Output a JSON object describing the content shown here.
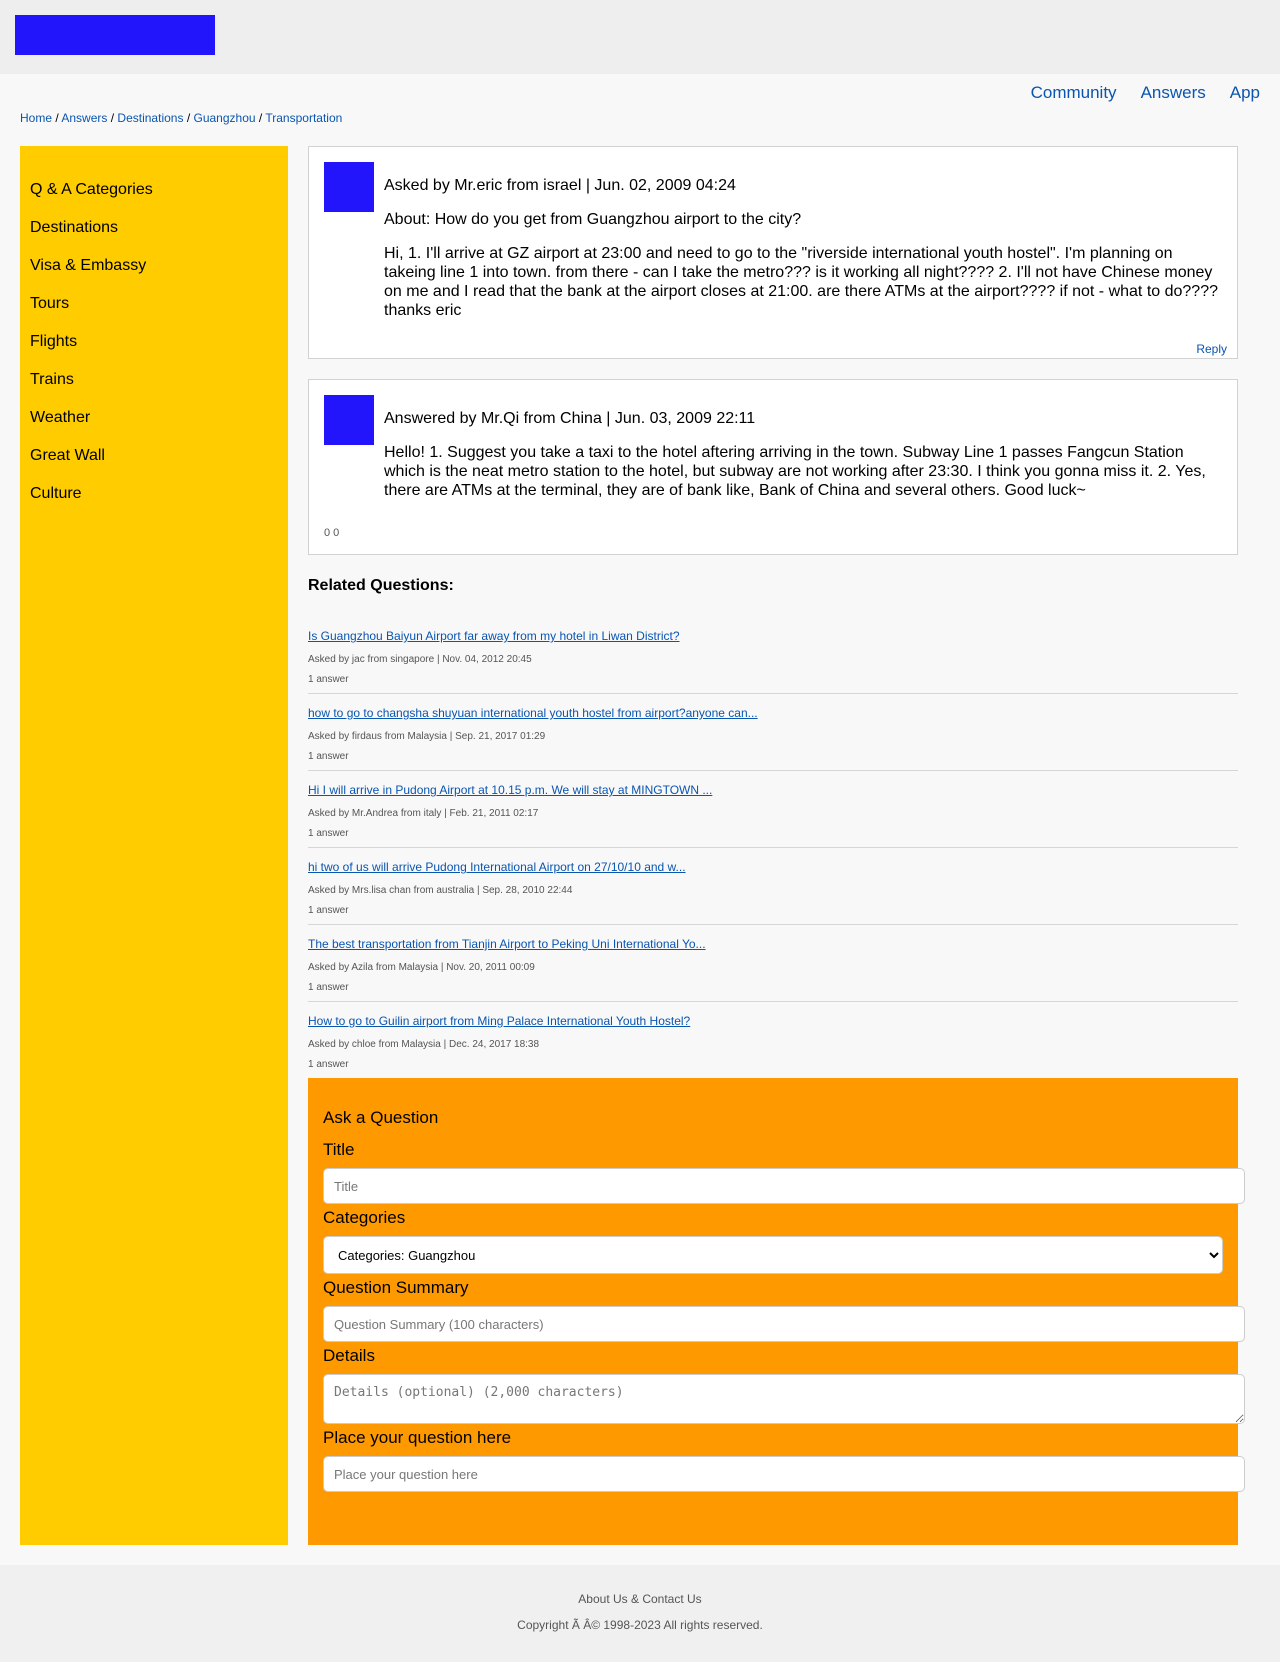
{
  "colors": {
    "logo": "#2215fb",
    "sidebar": "#ffcc00",
    "ask_panel": "#ff9900",
    "link": "#0a55b0"
  },
  "nav": {
    "community": "Community",
    "answers": "Answers",
    "app": "App"
  },
  "breadcrumb": {
    "home": "Home",
    "sep": "/",
    "answers": "Answers",
    "destinations": "Destinations",
    "guangzhou": "Guangzhou",
    "transportation": "Transportation"
  },
  "sidebar": {
    "items": [
      "Q & A Categories",
      "Destinations",
      "Visa & Embassy",
      "Tours",
      "Flights",
      "Trains",
      "Weather",
      "Great Wall",
      "Culture"
    ]
  },
  "question": {
    "meta": "Asked by Mr.eric from israel | Jun. 02, 2009 04:24",
    "about": "About: How do you get from Guangzhou airport to the city?",
    "text": "Hi, 1. I'll arrive at GZ airport at 23:00 and need to go to the \"riverside international youth hostel\". I'm planning on takeing line 1 into town. from there - can I take the metro??? is it working all night???? 2. I'll not have Chinese money on me and I read that the bank at the airport closes at 21:00. are there ATMs at the airport???? if not - what to do???? thanks eric",
    "reply_label": "Reply"
  },
  "answer": {
    "meta": "Answered by Mr.Qi from China | Jun. 03, 2009 22:11",
    "text": "Hello! 1. Suggest you take a taxi to the hotel aftering arriving in the town. Subway Line 1 passes Fangcun Station which is the neat metro station to the hotel, but subway are not working after 23:30. I think you gonna miss it. 2. Yes, there are ATMs at the terminal, they are of bank like, Bank of China and several others. Good luck~",
    "counts": "0 0"
  },
  "related": {
    "title": "Related Questions:",
    "items": [
      {
        "title": "Is Guangzhou Baiyun Airport far away from my hotel in Liwan District?",
        "meta": "Asked by jac from singapore | Nov. 04, 2012 20:45",
        "count": "1 answer"
      },
      {
        "title": "how to go to changsha shuyuan international youth hostel from airport?anyone can...",
        "meta": "Asked by firdaus from Malaysia | Sep. 21, 2017 01:29",
        "count": "1 answer"
      },
      {
        "title": "Hi I will arrive in Pudong Airport at 10.15 p.m. We will stay at MINGTOWN ...",
        "meta": "Asked by Mr.Andrea from italy | Feb. 21, 2011 02:17",
        "count": "1 answer"
      },
      {
        "title": "hi two of us will arrive Pudong International Airport on 27/10/10 and w...",
        "meta": "Asked by Mrs.lisa chan from australia | Sep. 28, 2010 22:44",
        "count": "1 answer"
      },
      {
        "title": "The best transportation from Tianjin Airport to Peking Uni International Yo...",
        "meta": "Asked by Azila from Malaysia | Nov. 20, 2011 00:09",
        "count": "1 answer"
      },
      {
        "title": "How to go to Guilin airport from Ming Palace International Youth Hostel?",
        "meta": "Asked by chloe from Malaysia | Dec. 24, 2017 18:38",
        "count": "1 answer"
      }
    ]
  },
  "ask": {
    "heading": "Ask a Question",
    "title_label": "Title",
    "title_placeholder": "Title",
    "categories_label": "Categories",
    "categories_selected": "Categories: Guangzhou",
    "summary_label": "Question Summary",
    "summary_placeholder": "Question Summary (100 characters)",
    "details_label": "Details",
    "details_placeholder": "Details (optional) (2,000 characters)",
    "place_label": "Place your question here",
    "place_placeholder": "Place your question here"
  },
  "footer": {
    "about": "About Us & Contact Us",
    "copyright": "Copyright Ã Â© 1998-2023 All rights reserved."
  }
}
